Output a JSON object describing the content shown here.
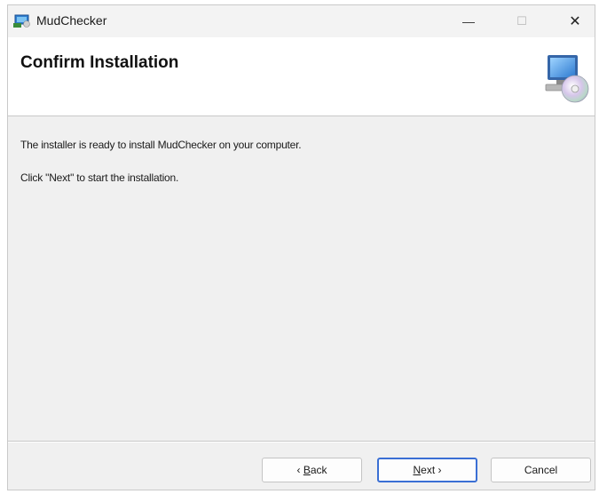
{
  "window": {
    "title": "MudChecker",
    "icon": "installer-app-icon"
  },
  "title_controls": {
    "minimize_glyph": "—",
    "maximize_glyph": "☐",
    "close_glyph": "✕"
  },
  "header": {
    "title": "Confirm Installation",
    "icon": "computer-disc-icon"
  },
  "content": {
    "message_1": "The installer is ready to install MudChecker on your computer.",
    "message_2": "Click \"Next\" to start the installation."
  },
  "buttons": {
    "back_prefix": "‹ ",
    "back_mnemonic": "B",
    "back_rest": "ack",
    "next_mnemonic": "N",
    "next_rest": "ext",
    "next_suffix": " ›",
    "cancel": "Cancel"
  },
  "colors": {
    "accent": "#3a6fd4",
    "window_bg": "#f0f0f0",
    "header_bg": "#ffffff"
  }
}
